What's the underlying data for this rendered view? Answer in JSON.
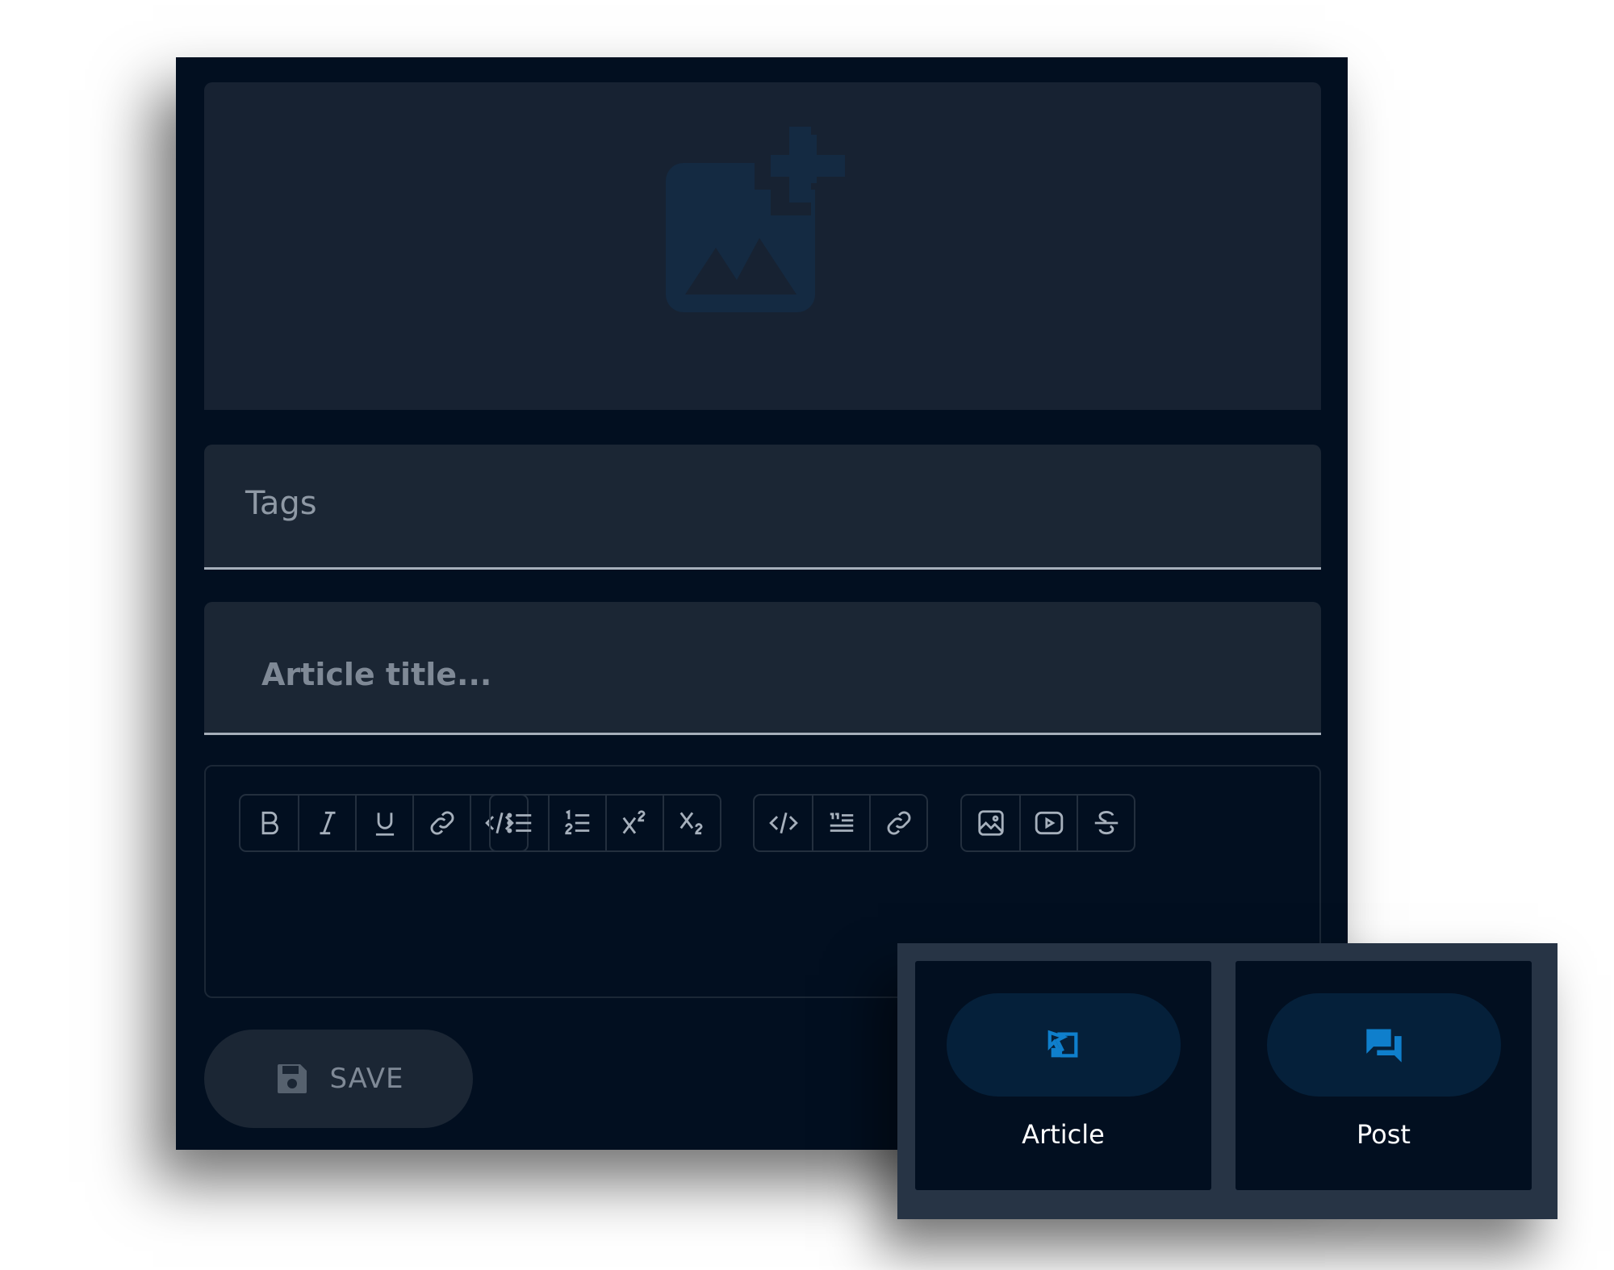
{
  "editor": {
    "upload_icon": "add-image-icon",
    "tags_placeholder": "Tags",
    "title_placeholder": "Article title...",
    "toolbar": {
      "groups": [
        [
          "bold-icon",
          "italic-icon",
          "underline-icon",
          "link-icon",
          "code-icon"
        ],
        [
          "bullet-list-icon",
          "numbered-list-icon",
          "superscript-icon",
          "subscript-icon"
        ],
        [
          "code-block-icon",
          "blockquote-icon",
          "link-icon"
        ],
        [
          "image-icon",
          "video-icon",
          "strikethrough-icon"
        ]
      ]
    },
    "save_label": "SAVE",
    "save_icon": "floppy-disk-icon"
  },
  "type_picker": {
    "options": [
      {
        "label": "Article",
        "icon": "article-icon"
      },
      {
        "label": "Post",
        "icon": "forum-icon"
      }
    ]
  },
  "colors": {
    "background": "#020f20",
    "field": "#1b2634",
    "accent": "#0f7fcc",
    "text_muted": "#8f99a5"
  }
}
